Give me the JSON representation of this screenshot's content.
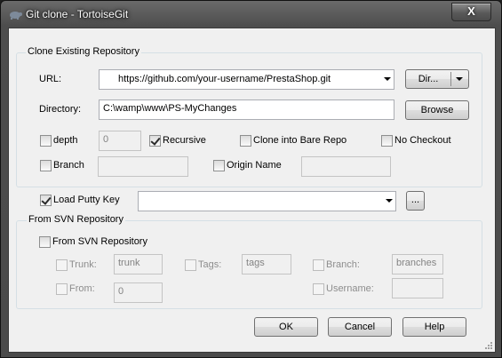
{
  "window": {
    "title": "Git clone - TortoiseGit",
    "close_label": "X",
    "app_icon": "tortoise-icon"
  },
  "clone_group": {
    "title": "Clone Existing Repository",
    "url_label": "URL:",
    "url_value": "https://github.com/your-username/PrestaShop.git",
    "dir_button": "Dir...",
    "directory_label": "Directory:",
    "directory_value": "C:\\wamp\\www\\PS-MyChanges",
    "browse_button": "Browse",
    "depth_label": "depth",
    "depth_value": "0",
    "depth_checked": false,
    "recursive_label": "Recursive",
    "recursive_checked": true,
    "bare_label": "Clone into Bare Repo",
    "bare_checked": false,
    "nocheckout_label": "No Checkout",
    "nocheckout_checked": false,
    "branch_label": "Branch",
    "branch_checked": false,
    "branch_value": "",
    "origin_label": "Origin Name",
    "origin_checked": false,
    "origin_value": ""
  },
  "putty": {
    "label": "Load Putty Key",
    "checked": true,
    "value": "",
    "browse_button": "..."
  },
  "svn_group": {
    "title": "From SVN Repository",
    "svn_label": "From SVN Repository",
    "svn_checked": false,
    "trunk_label": "Trunk:",
    "trunk_value": "trunk",
    "tags_label": "Tags:",
    "tags_value": "tags",
    "branch_label": "Branch:",
    "branch_value": "branches",
    "from_label": "From:",
    "from_value": "0",
    "username_label": "Username:",
    "username_value": ""
  },
  "footer": {
    "ok": "OK",
    "cancel": "Cancel",
    "help": "Help"
  }
}
